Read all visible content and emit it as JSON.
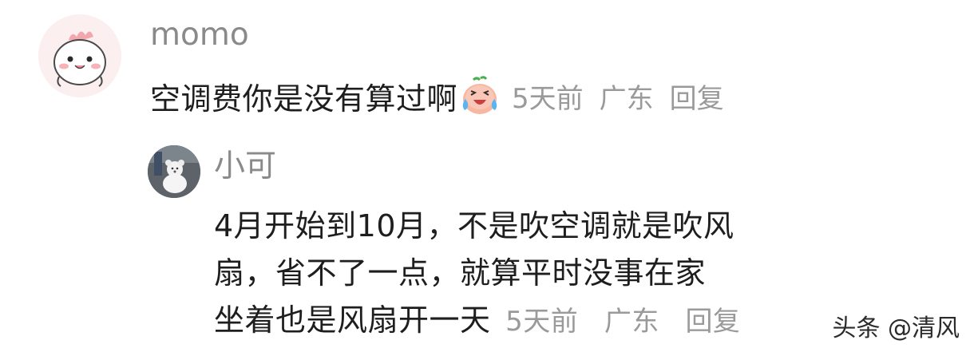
{
  "comment": {
    "author": "momo",
    "text": "空调费你是没有算过啊",
    "emoji": "crying-laughing-face-icon",
    "time": "5天前",
    "location": "广东",
    "reply_label": "回复"
  },
  "reply": {
    "author": "小可",
    "lines": [
      "4月开始到10月，不是吹空调就是吹风",
      "扇，省不了一点，就算平时没事在家",
      "坐着也是风扇开一天"
    ],
    "time": "5天前",
    "location": "广东",
    "reply_label": "回复"
  },
  "watermark": "头条 @清风"
}
